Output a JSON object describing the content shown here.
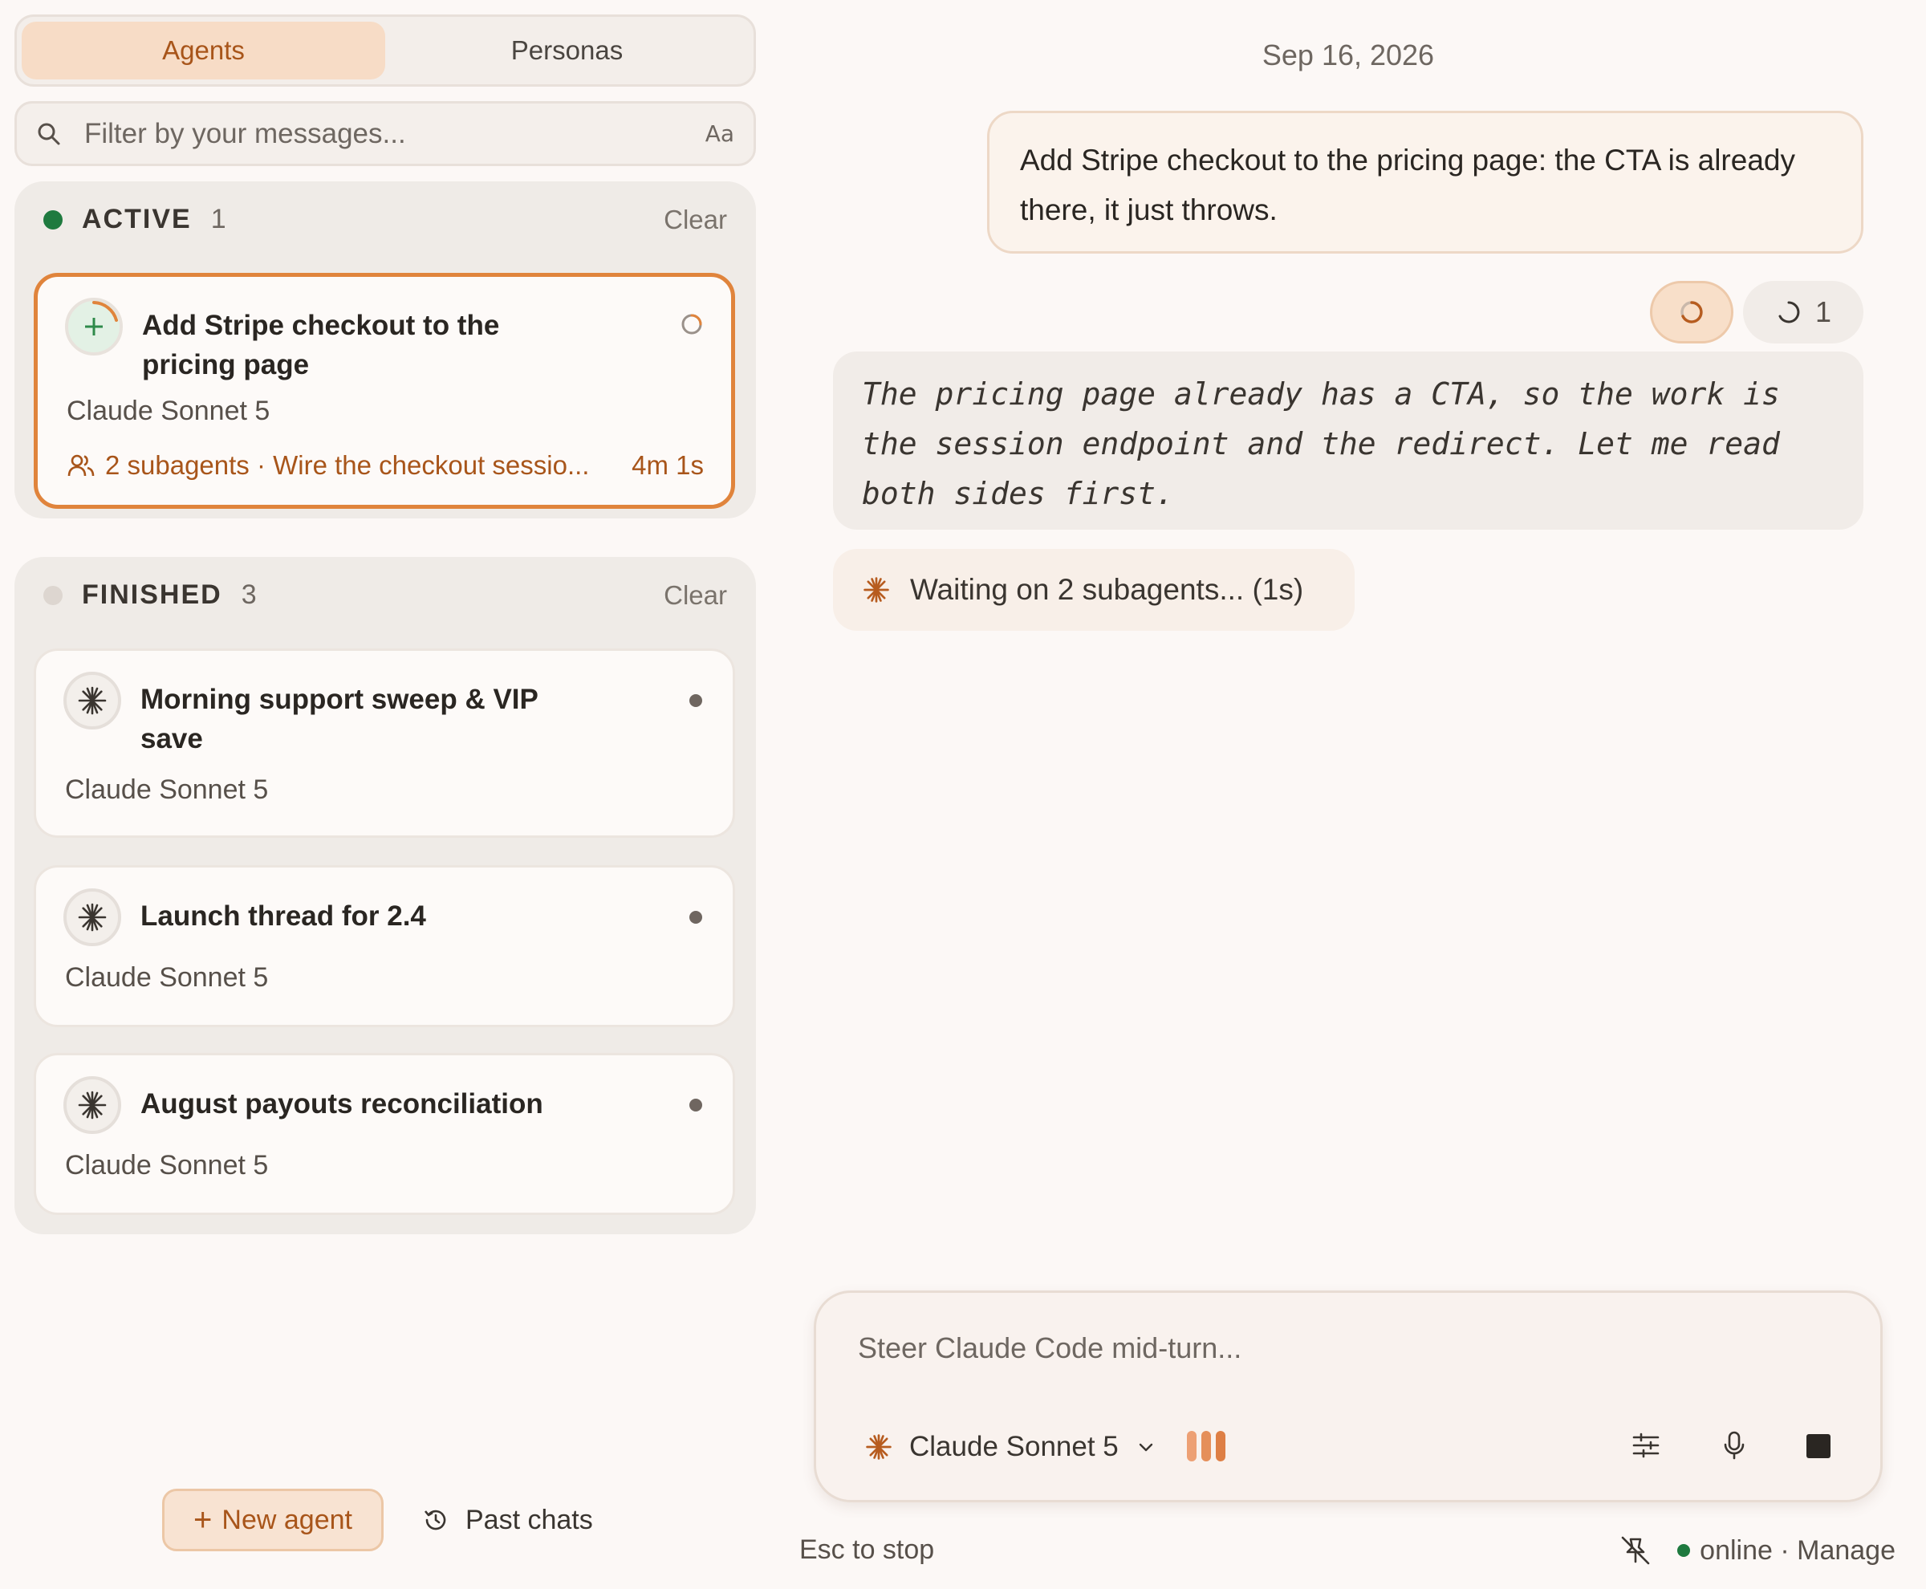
{
  "tabs": [
    {
      "label": "Agents",
      "active": true
    },
    {
      "label": "Personas",
      "active": false
    }
  ],
  "filter": {
    "placeholder": "Filter by your messages...",
    "case_toggle": "Aa"
  },
  "active_group": {
    "title": "ACTIVE",
    "count": "1",
    "clear_label": "Clear",
    "status_color": "#1f7a3f",
    "cards": [
      {
        "title": "Add Stripe checkout to the pricing page",
        "model": "Claude Sonnet 5",
        "subagents": "2 subagents · Wire the checkout sessio...",
        "elapsed": "4m 1s",
        "icon": "plus-icon"
      }
    ]
  },
  "finished_group": {
    "title": "FINISHED",
    "count": "3",
    "clear_label": "Clear",
    "cards": [
      {
        "title": "Morning support sweep & VIP save",
        "model": "Claude Sonnet 5",
        "icon": "asterisk-icon"
      },
      {
        "title": "Launch thread for 2.4",
        "model": "Claude Sonnet 5",
        "icon": "asterisk-icon"
      },
      {
        "title": "August payouts reconciliation",
        "model": "Claude Sonnet 5",
        "icon": "asterisk-icon"
      }
    ]
  },
  "sidebar_actions": {
    "new_agent": "New agent",
    "past_chats": "Past chats"
  },
  "chat": {
    "date": "Sep 16, 2026",
    "user_message": "Add Stripe checkout to the pricing page: the CTA is already there, it just throws.",
    "subagent_pill_count": "1",
    "thinking": "The pricing page already has a CTA, so the work is the session endpoint and the redirect. Let me read both sides first.",
    "waiting": "Waiting on 2 subagents... (1s)"
  },
  "composer": {
    "placeholder": "Steer Claude Code mid-turn...",
    "model": "Claude Sonnet 5"
  },
  "footer": {
    "hint": "Esc to stop",
    "status": "online · Manage"
  },
  "colors": {
    "accent": "#e0843c",
    "accent_text": "#a8551a",
    "online": "#1f7a3f",
    "background": "#fcf8f6"
  }
}
